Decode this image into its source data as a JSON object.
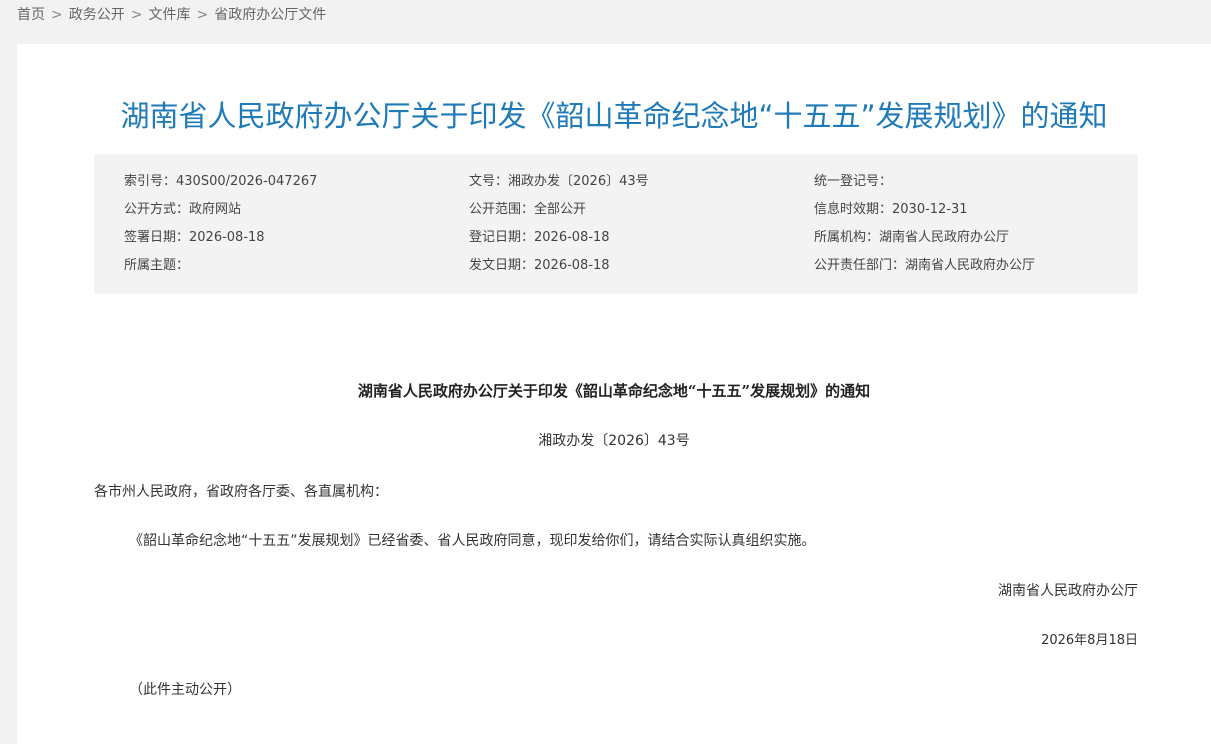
{
  "breadcrumb": {
    "items": [
      "首页",
      "政务公开",
      "文件库",
      "省政府办公厅文件"
    ],
    "separator": ">"
  },
  "title": "湖南省人民政府办公厅关于印发《韶山革命纪念地“十五五”发展规划》的通知",
  "meta": {
    "col1": [
      "索引号：430S00/2026-047267",
      "公开方式：政府网站",
      "签署日期：2026-08-18",
      "所属主题："
    ],
    "col2": [
      "文号：湘政办发〔2026〕43号",
      "公开范围：全部公开",
      "登记日期：2026-08-18",
      "发文日期：2026-08-18"
    ],
    "col3": [
      "统一登记号：",
      "信息时效期：2030-12-31",
      "所属机构：湖南省人民政府办公厅",
      "公开责任部门：湖南省人民政府办公厅"
    ]
  },
  "document": {
    "heading": "湖南省人民政府办公厅关于印发《韶山革命纪念地“十五五”发展规划》的通知",
    "number": "湘政办发〔2026〕43号",
    "salutation": "各市州人民政府，省政府各厅委、各直属机构：",
    "body": "《韶山革命纪念地“十五五”发展规划》已经省委、省人民政府同意，现印发给你们，请结合实际认真组织实施。",
    "signature": "湖南省人民政府办公厅",
    "date": "2026年8月18日",
    "note": "（此件主动公开）"
  },
  "colors": {
    "title": "#1f7ab8",
    "page_bg": "#f2f2f2",
    "meta_bg": "#f3f3f3"
  }
}
